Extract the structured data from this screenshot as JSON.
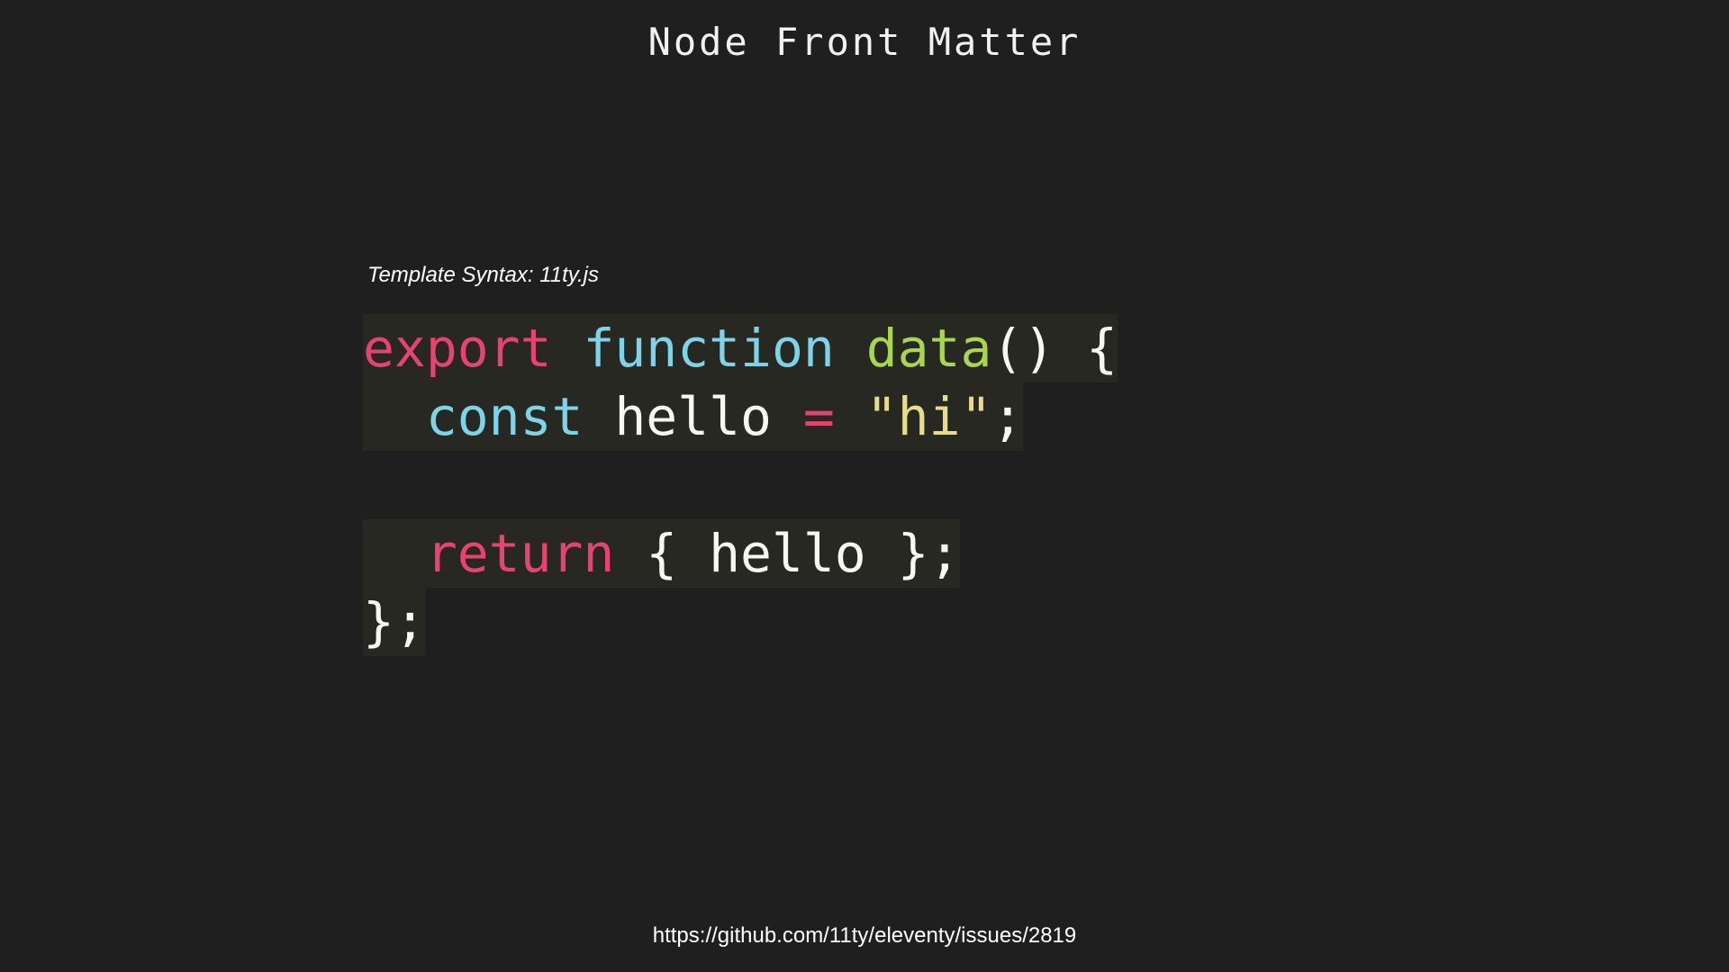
{
  "slide": {
    "title": "Node Front Matter",
    "caption": "Template Syntax: 11ty.js",
    "source_url": "https://github.com/11ty/eleventy/issues/2819"
  },
  "code": {
    "line1": {
      "kw_export": "export",
      "kw_function": "function",
      "fn_name": "data",
      "rest": "() {"
    },
    "line2": {
      "indent": "  ",
      "kw_const": "const",
      "var_name": "hello",
      "op_eq": "=",
      "str_val": "\"hi\"",
      "semi": ";"
    },
    "line4": {
      "indent": "  ",
      "kw_return": "return",
      "rest": "{ hello };"
    },
    "line5": {
      "rest": "};"
    }
  },
  "colors": {
    "background": "#1f1f1f",
    "keyword": "#e8436e",
    "function_keyword": "#7dd3e8",
    "function_name": "#a9d64a",
    "string": "#e6dc8c",
    "code_highlight": "#272822"
  }
}
